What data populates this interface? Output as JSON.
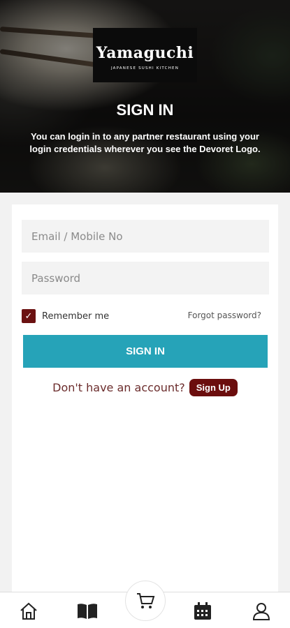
{
  "hero": {
    "brand": "Yamaguchi",
    "brand_subtitle": "JAPANESE SUSHI KITCHEN",
    "title": "SIGN IN",
    "description": "You can login in to any partner restaurant using your login credentials wherever you see the Devoret Logo."
  },
  "form": {
    "email_placeholder": "Email / Mobile No",
    "password_placeholder": "Password",
    "remember_label": "Remember me",
    "remember_checked": true,
    "forgot_label": "Forgot password?",
    "signin_label": "SIGN IN",
    "no_account_text": "Don't have an account?",
    "signup_label": "Sign Up"
  },
  "nav": {
    "items": [
      "home-icon",
      "menu-book-icon",
      "cart-icon",
      "calendar-icon",
      "profile-icon"
    ]
  },
  "colors": {
    "accent": "#26a3b8",
    "brand_maroon": "#6b0d0d"
  }
}
